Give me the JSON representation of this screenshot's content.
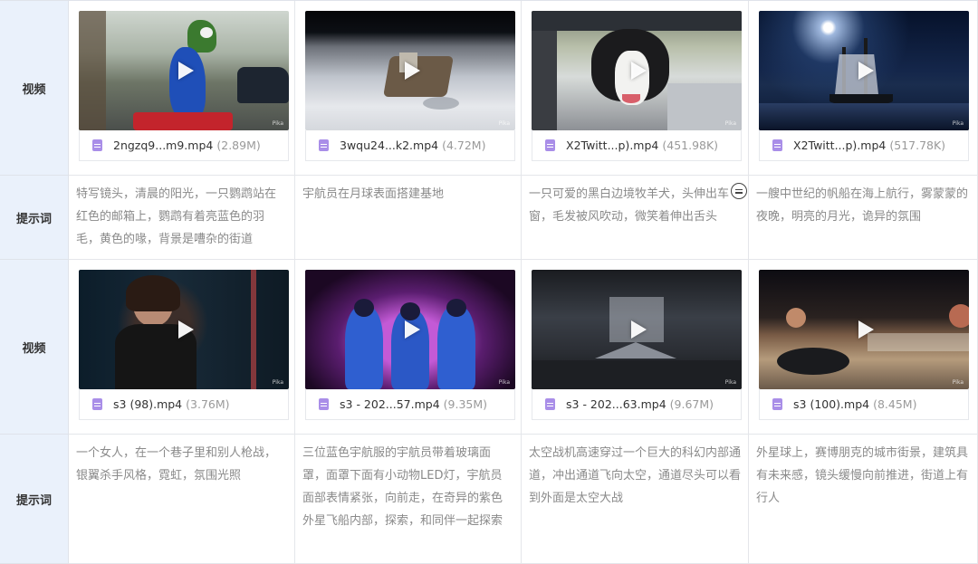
{
  "rows": [
    {
      "type": "video",
      "header": "视频",
      "items": [
        {
          "file": "2ngzq9...m9.mp4",
          "size": "(2.89M)"
        },
        {
          "file": "3wqu24...k2.mp4",
          "size": "(4.72M)"
        },
        {
          "file": "X2Twitt...p).mp4",
          "size": "(451.98K)"
        },
        {
          "file": "X2Twitt...p).mp4",
          "size": "(517.78K)"
        }
      ]
    },
    {
      "type": "prompt",
      "header": "提示词",
      "items": [
        "特写镜头，清晨的阳光，一只鹦鹉站在红色的邮箱上，鹦鹉有着亮蓝色的羽毛，黄色的喙，背景是嘈杂的街道",
        "宇航员在月球表面搭建基地",
        "一只可爱的黑白边境牧羊犬，头伸出车窗，毛发被风吹动，微笑着伸出舌头",
        "一艘中世纪的帆船在海上航行，雾蒙蒙的夜晚，明亮的月光，诡异的氛围"
      ]
    },
    {
      "type": "video",
      "header": "视频",
      "items": [
        {
          "file": "s3 (98).mp4",
          "size": "(3.76M)"
        },
        {
          "file": "s3 - 202...57.mp4",
          "size": "(9.35M)"
        },
        {
          "file": "s3 - 202...63.mp4",
          "size": "(9.67M)"
        },
        {
          "file": "s3 (100).mp4",
          "size": "(8.45M)"
        }
      ]
    },
    {
      "type": "prompt",
      "header": "提示词",
      "items": [
        "一个女人，在一个巷子里和别人枪战，银翼杀手风格，霓虹，氛围光照",
        "三位蓝色宇航服的宇航员带着玻璃面罩，面罩下面有小动物LED灯，宇航员面部表情紧张，向前走，在奇异的紫色外星飞船内部，探索，和同伴一起探索",
        "太空战机高速穿过一个巨大的科幻内部通道，冲出通道飞向太空，通道尽头可以看到外面是太空大战",
        "外星球上，赛博朋克的城市街景，建筑具有未来感，镜头缓慢向前推进，街道上有行人"
      ]
    }
  ],
  "icons": {
    "play": "play-icon",
    "file": "video-file-icon",
    "more": "more-menu-icon"
  },
  "colors": {
    "header_bg": "#eaf1fb",
    "file_icon": "#a98ee8",
    "prompt_text": "#8a8a8a"
  }
}
